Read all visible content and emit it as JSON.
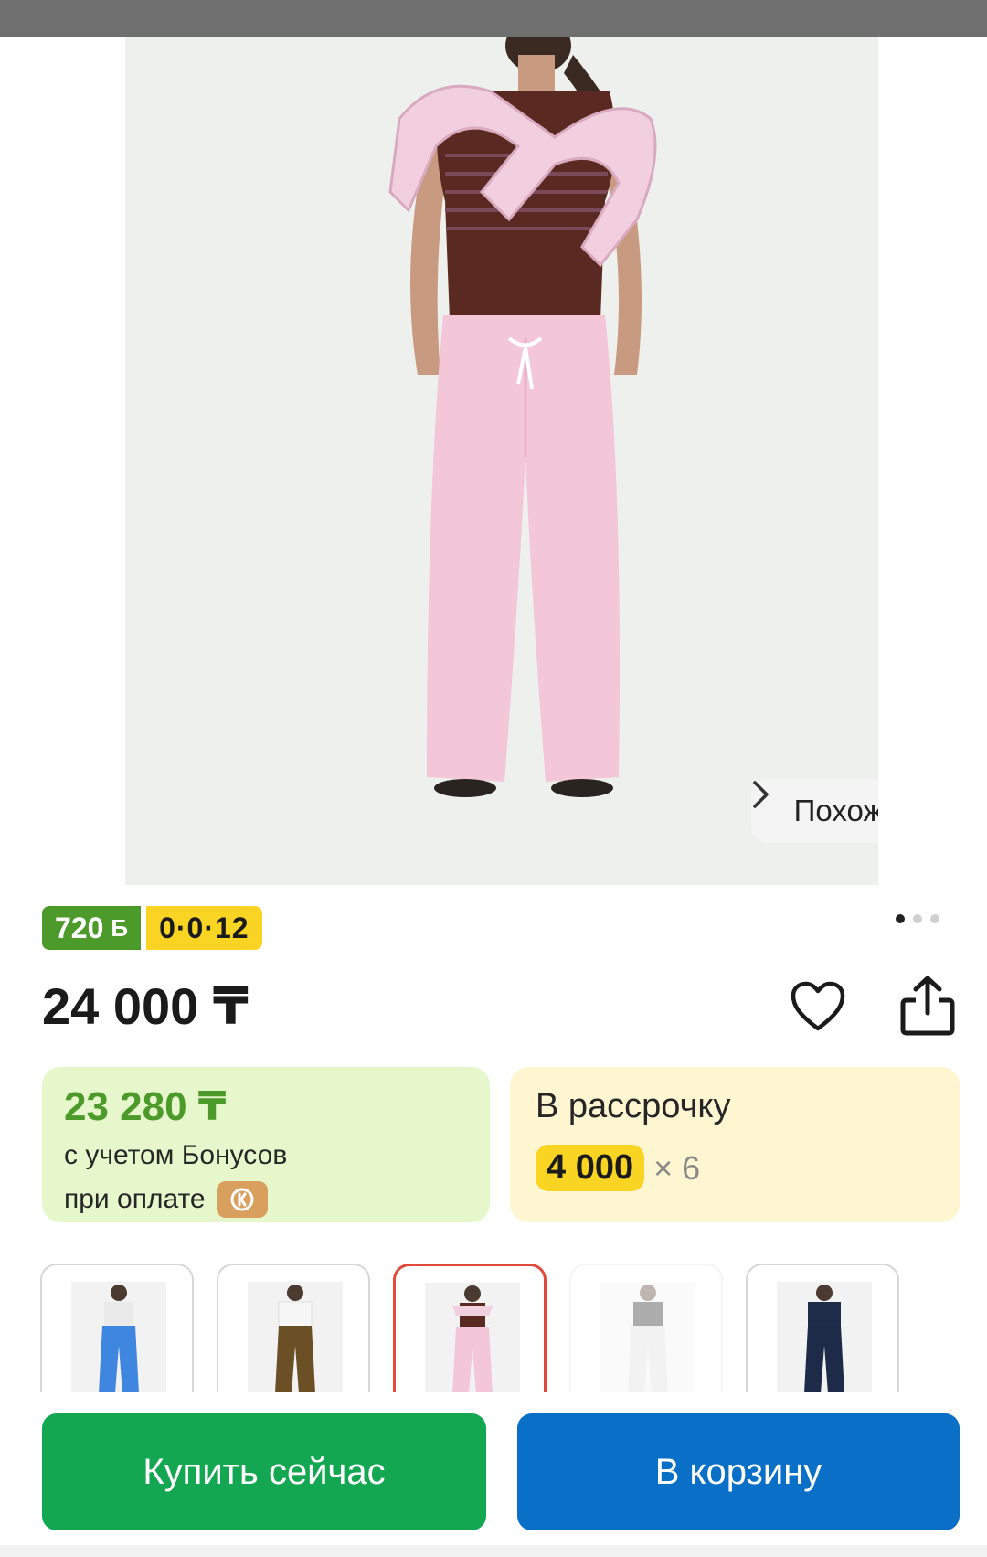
{
  "product": {
    "price": "24 000 ₸",
    "image_dots": 3,
    "active_image_dot": 0
  },
  "badges": {
    "bonus_value": "720",
    "bonus_symbol": "Б",
    "installment_plan": "0·0·12",
    "bonus_color": "#4c9a2a",
    "plan_color": "#f9d423"
  },
  "gallery": {
    "similar_label": "Похожие"
  },
  "bonus_card": {
    "amount": "23 280 ₸",
    "line1": "с учетом Бонусов",
    "line2": "при оплате"
  },
  "installment_card": {
    "title": "В рассрочку",
    "monthly": "4 000",
    "months": "× 6"
  },
  "variants": [
    {
      "color": "blue",
      "selected": false
    },
    {
      "color": "olive",
      "selected": false
    },
    {
      "color": "pink",
      "selected": true
    },
    {
      "color": "white",
      "selected": false
    },
    {
      "color": "navy",
      "selected": false
    }
  ],
  "actions": {
    "buy_now": "Купить сейчас",
    "add_to_cart": "В корзину"
  },
  "colors": {
    "buy_button": "#14a752",
    "cart_button": "#0a6fc7",
    "selected_border": "#e04a3a"
  }
}
